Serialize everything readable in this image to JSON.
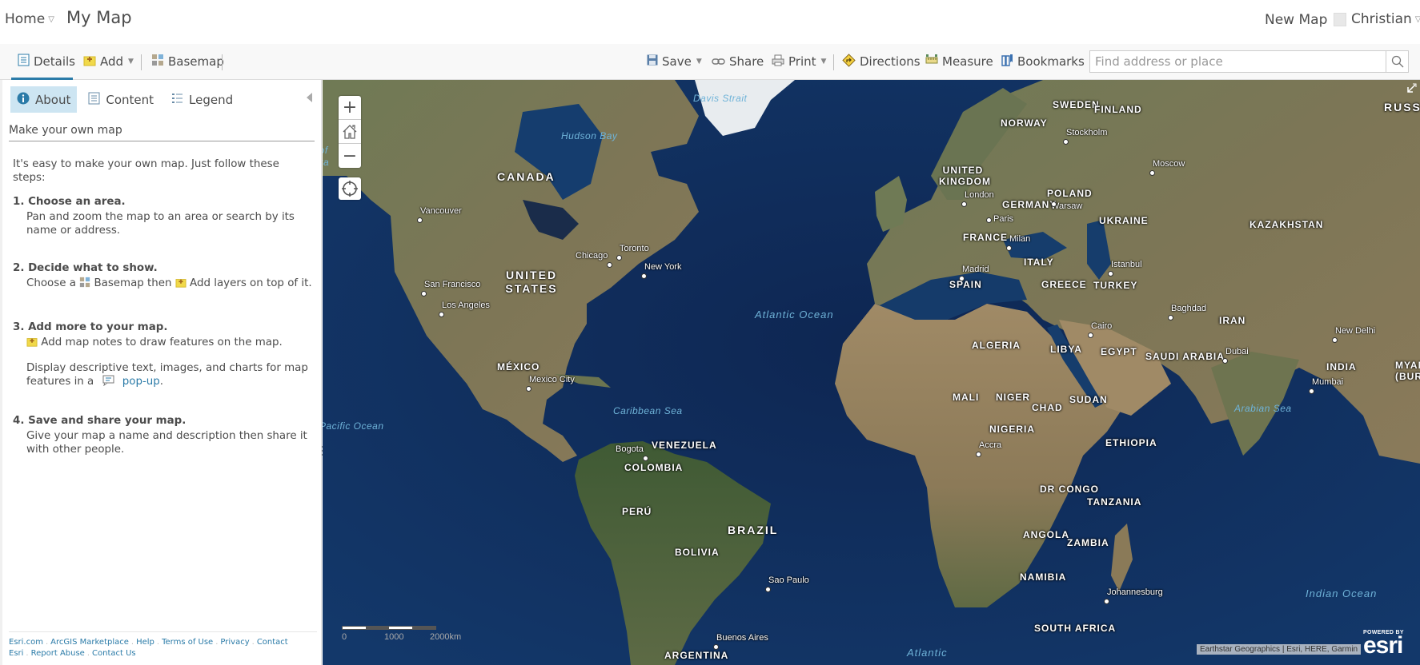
{
  "header": {
    "home_label": "Home",
    "map_title": "My Map",
    "new_map_label": "New Map",
    "user_name": "Christian"
  },
  "toolbar": {
    "details_label": "Details",
    "add_label": "Add",
    "basemap_label": "Basemap",
    "save_label": "Save",
    "share_label": "Share",
    "print_label": "Print",
    "directions_label": "Directions",
    "measure_label": "Measure",
    "bookmarks_label": "Bookmarks",
    "search_placeholder": "Find address or place",
    "active_tab_color": "#2b7ba8"
  },
  "panel": {
    "tabs": [
      {
        "label": "About",
        "active": true,
        "icon": "info-icon"
      },
      {
        "label": "Content",
        "active": false,
        "icon": "content-list-icon"
      },
      {
        "label": "Legend",
        "active": false,
        "icon": "legend-icon"
      }
    ],
    "heading": "Make your own map",
    "intro": "It's easy to make your own map. Just follow these steps:",
    "steps": [
      {
        "title": "1. Choose an area.",
        "text": "Pan and zoom the map to an area or search by its name or address."
      },
      {
        "title": "2. Decide what to show.",
        "text_a": "Choose a",
        "text_b": "Basemap then",
        "text_c": "Add layers on top of it."
      },
      {
        "title": "3. Add more to your map.",
        "text": "Add map notes to draw features on the map.",
        "text2_a": "Display descriptive text, images, and charts for map features in a",
        "text2_link": "pop-up",
        "text2_end": "."
      },
      {
        "title": "4. Save and share your map.",
        "text": "Give your map a name and description then share it with other people."
      }
    ],
    "footer_links": [
      "Esri.com",
      "ArcGIS Marketplace",
      "Help",
      "Terms of Use",
      "Privacy",
      "Contact Esri",
      "Report Abuse",
      "Contact Us"
    ]
  },
  "map": {
    "zoom_in": "+",
    "zoom_out": "−",
    "scale_labels": [
      "0",
      "1000",
      "2000km"
    ],
    "attribution": "Earthstar Geographics | Esri, HERE, Garmin",
    "powered_by": "POWERED BY",
    "logo": "esri",
    "countries": [
      "CANADA",
      "UNITED STATES",
      "MÉXICO",
      "VENEZUELA",
      "COLOMBIA",
      "PERÚ",
      "BRAZIL",
      "BOLIVIA",
      "ARGENTINA",
      "SWEDEN",
      "FINLAND",
      "NORWAY",
      "UNITED KINGDOM",
      "GERMANY",
      "POLAND",
      "UKRAINE",
      "FRANCE",
      "ITALY",
      "SPAIN",
      "GREECE",
      "TURKEY",
      "KAZAKHSTAN",
      "RUSSIA",
      "IRAN",
      "ALGERIA",
      "LIBYA",
      "EGYPT",
      "SAUDI ARABIA",
      "INDIA",
      "MYANMAR (BURMA)",
      "MALI",
      "NIGER",
      "CHAD",
      "SUDAN",
      "NIGERIA",
      "ETHIOPIA",
      "DR CONGO",
      "TANZANIA",
      "ANGOLA",
      "ZAMBIA",
      "NAMIBIA",
      "SOUTH AFRICA"
    ],
    "cities": [
      "Vancouver",
      "Toronto",
      "Chicago",
      "New York",
      "San Francisco",
      "Los Angeles",
      "Mexico City",
      "Bogota",
      "Sao Paulo",
      "Buenos Aires",
      "Stockholm",
      "Moscow",
      "London",
      "Paris",
      "Warsaw",
      "Milan",
      "Madrid",
      "Istanbul",
      "Baghdad",
      "Cairo",
      "Dubai",
      "New Delhi",
      "Mumbai",
      "Accra",
      "Johannesburg"
    ],
    "water": [
      "Davis Strait",
      "Hudson Bay",
      "Gulf of Alaska",
      "Atlantic Ocean",
      "Caribbean Sea",
      "Pacific Ocean",
      "Arabian Sea",
      "Indian Ocean",
      "Atlantic"
    ]
  }
}
